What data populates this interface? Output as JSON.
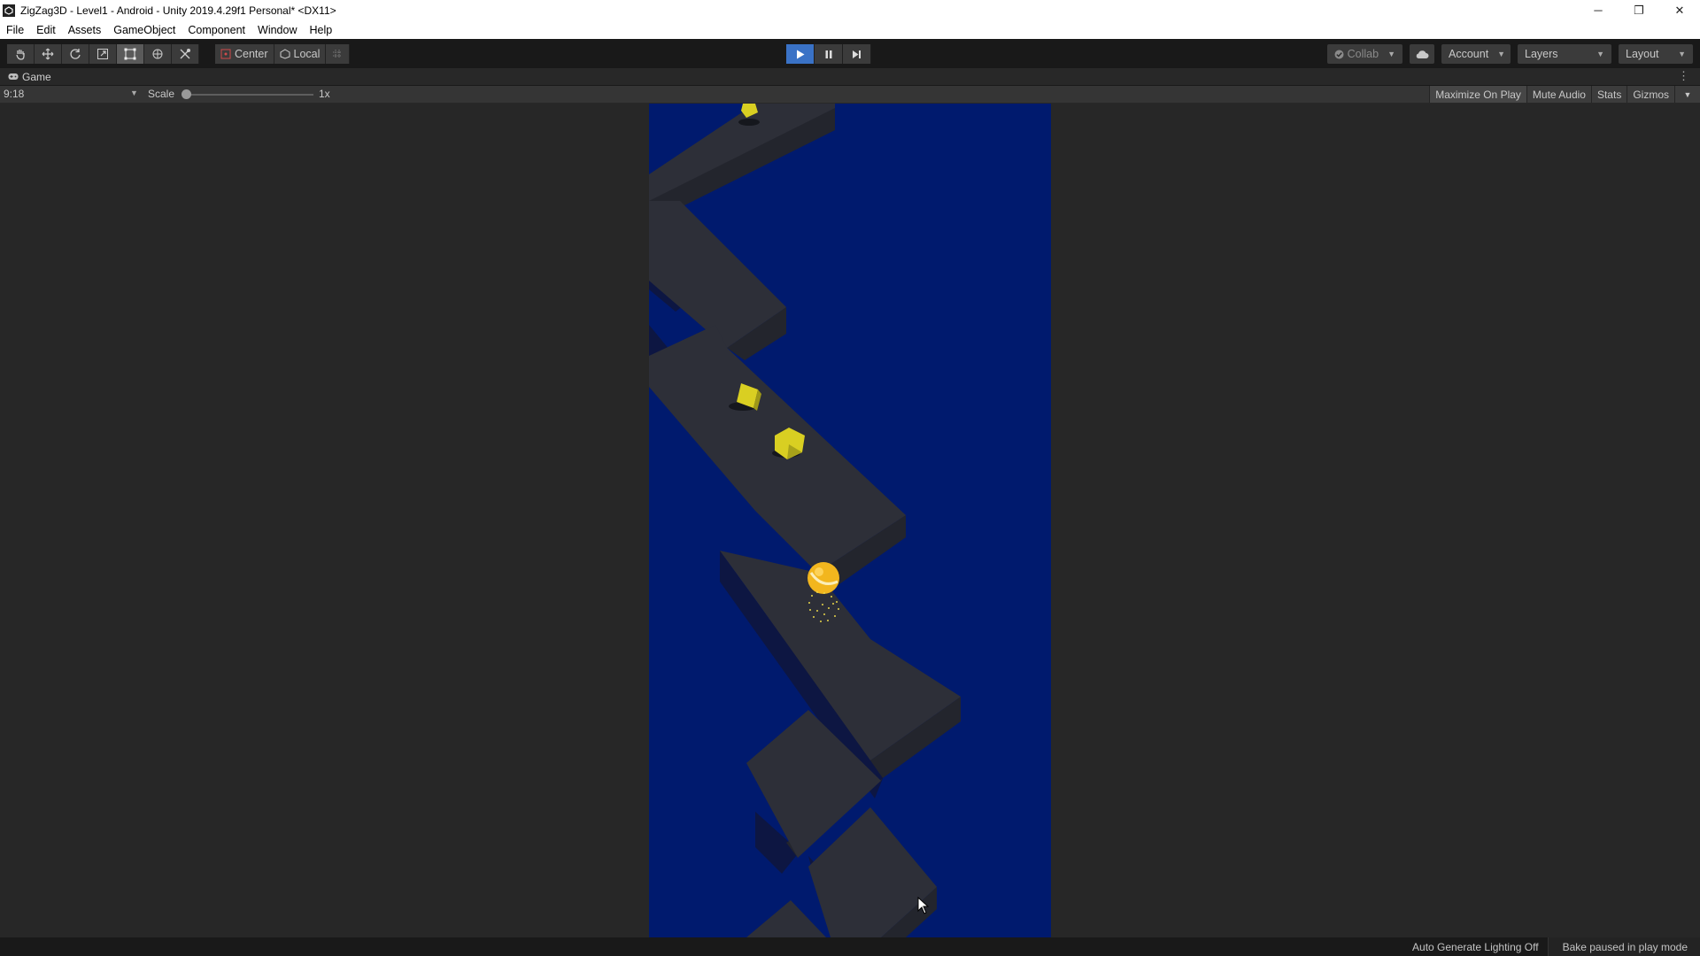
{
  "window": {
    "title": "ZigZag3D - Level1 - Android - Unity 2019.4.29f1 Personal* <DX11>",
    "controls": [
      "─",
      "❐",
      "✕"
    ]
  },
  "menu": [
    "File",
    "Edit",
    "Assets",
    "GameObject",
    "Component",
    "Window",
    "Help"
  ],
  "toolbar": {
    "tools": [
      "hand-tool-icon",
      "move-tool-icon",
      "rotate-tool-icon",
      "scale-tool-icon",
      "rect-tool-icon",
      "transform-tool-icon",
      "custom-tool-icon"
    ],
    "pivot_label": "Center",
    "rotation_label": "Local",
    "collab_label": "Collab",
    "account_label": "Account",
    "layers_label": "Layers",
    "layout_label": "Layout",
    "play_state": "playing"
  },
  "game_tab": {
    "label": "Game",
    "aspect": "9:18",
    "scale_label": "Scale",
    "scale_value": "1x",
    "maximize_on_play": "Maximize On Play",
    "mute_audio": "Mute Audio",
    "stats": "Stats",
    "gizmos": "Gizmos"
  },
  "status": {
    "lighting": "Auto Generate Lighting Off",
    "bake": "Bake paused in play mode"
  },
  "colors": {
    "game_background": "#001a6e",
    "platform_top": "#2d2f38",
    "gem": "#d9cf22",
    "ball": "#f2b61e",
    "play_accent": "#3a72c6"
  }
}
